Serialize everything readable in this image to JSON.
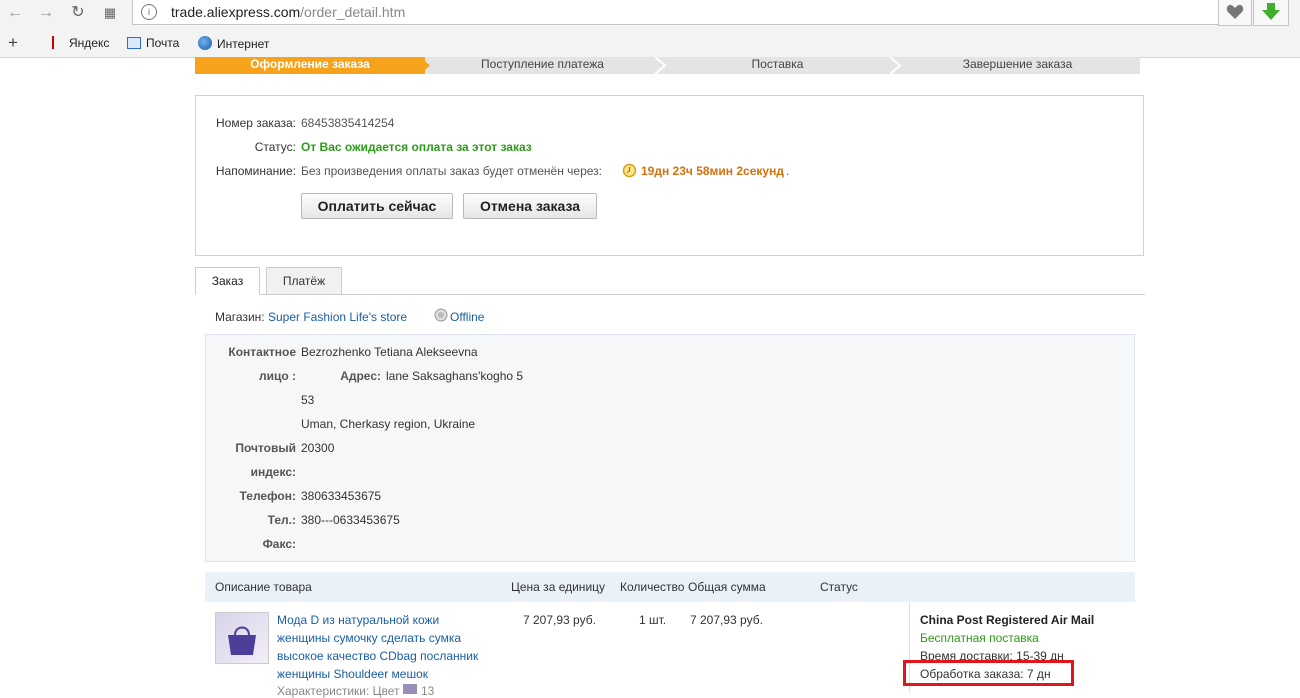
{
  "browser": {
    "url_host": "trade.aliexpress.com",
    "url_path": "/order_detail.htm",
    "bookmarks": [
      {
        "label": "Яндекс",
        "icon": "yandex-icon"
      },
      {
        "label": "Почта",
        "icon": "mail-icon"
      },
      {
        "label": "Интернет",
        "icon": "globe-icon"
      }
    ],
    "add_label": "+"
  },
  "steps": [
    "Оформление заказа",
    "Поступление платежа",
    "Поставка",
    "Завершение заказа"
  ],
  "order": {
    "number_label": "Номер заказа:",
    "number": "68453835414254",
    "status_label": "Статус:",
    "status": "От Вас ожидается оплата за этот заказ",
    "reminder_label": "Напоминание:",
    "reminder_text": "Без произведения оплаты заказ будет отменён через:",
    "countdown": "19дн 23ч 58мин 2секунд",
    "countdown_suffix": ".",
    "pay_button": "Оплатить сейчас",
    "cancel_button": "Отмена заказа"
  },
  "tabs": [
    "Заказ",
    "Платёж"
  ],
  "store": {
    "label": "Магазин:",
    "name": "Super Fashion Life's store",
    "status": "Offline"
  },
  "address": {
    "contact_label_1": "Контактное",
    "contact_label_2": "лицо :",
    "contact": "Bezrozhenko Tetiana Alekseevna",
    "addr_label": "Адрес:",
    "street": "lane Saksaghans'kogho 5",
    "house": "53",
    "city": "Uman, Cherkasy region, Ukraine",
    "postal_label_1": "Почтовый",
    "postal_label_2": "индекс:",
    "postal": "20300",
    "phone_label": "Телефон:",
    "phone": "380633453675",
    "tel_label": "Тел.:",
    "tel": "380---0633453675",
    "fax_label": "Факс:"
  },
  "table": {
    "headers": [
      "Описание товара",
      "Цена за единицу",
      "Количество",
      "Общая сумма",
      "Статус"
    ],
    "product": {
      "title_lines": [
        "Мода D из натуральной кожи",
        "женщины сумочку сделать сумка",
        "высокое качество CDbag посланник",
        "женщины Shouldeer мешок"
      ],
      "characteristics": "Характеристики: Цвет",
      "char_value": "13",
      "price": "7 207,93 руб.",
      "qty": "1 шт.",
      "total": "7 207,93 руб."
    },
    "shipping": {
      "method": "China Post Registered Air Mail",
      "free": "Бесплатная поставка",
      "delivery": "Время доставки: 15-39 дн",
      "processing": "Обработка заказа: 7 дн"
    }
  },
  "colors": {
    "step_active": "#f7a21b",
    "status_green": "#2e9a1a",
    "countdown_orange": "#d4700d",
    "link_blue": "#1a5ea5",
    "highlight_red": "#e0161b"
  }
}
